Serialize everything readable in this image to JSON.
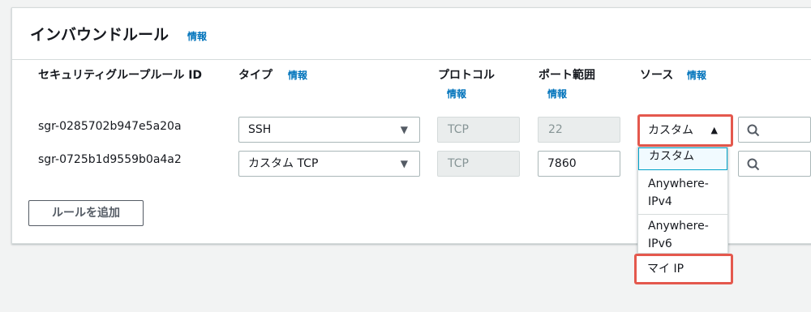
{
  "panel": {
    "title": "インバウンドルール",
    "title_info": "情報",
    "add_rule_button": "ルールを追加"
  },
  "columns": {
    "rule_id": "セキュリティグループルール ID",
    "type": "タイプ",
    "type_info": "情報",
    "protocol": "プロトコル",
    "protocol_info": "情報",
    "port_range": "ポート範囲",
    "port_range_info": "情報",
    "source": "ソース",
    "source_info": "情報"
  },
  "rules": [
    {
      "id": "sgr-0285702b947e5a20a",
      "type": "SSH",
      "protocol": "TCP",
      "port": "22",
      "source": "カスタム"
    },
    {
      "id": "sgr-0725b1d9559b0a4a2",
      "type": "カスタム TCP",
      "protocol": "TCP",
      "port": "7860",
      "source": "カスタム"
    }
  ],
  "source_dropdown": {
    "options": [
      "カスタム",
      "Anywhere-IPv4",
      "Anywhere-IPv6",
      "マイ IP"
    ],
    "selected": "カスタム",
    "option_lines": {
      "ipv4_a": "Anywhere-",
      "ipv4_b": "IPv4",
      "ipv6_a": "Anywhere-",
      "ipv6_b": "IPv6"
    }
  },
  "icons": {
    "select_caret": "caret-down-icon",
    "open_caret": "caret-up-icon",
    "search": "search-icon"
  },
  "colors": {
    "link": "#0073bb",
    "highlight": "#e4584d",
    "focus": "#00a1c9"
  }
}
